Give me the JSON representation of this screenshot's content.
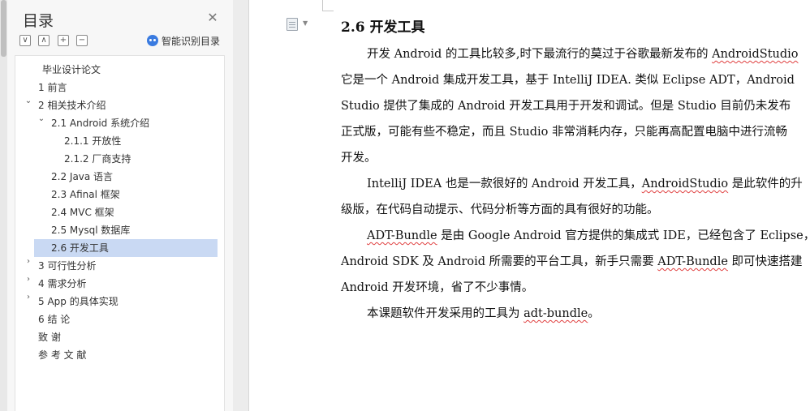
{
  "toc": {
    "title": "目录",
    "smart_label": "智能识别目录",
    "toolbar": {
      "collapse": "∨",
      "expand": "∧",
      "add": "+",
      "remove": "−"
    },
    "items": [
      {
        "label": "毕业设计论文"
      },
      {
        "label": "1 前言"
      },
      {
        "label": "2 相关技术介绍"
      },
      {
        "label": "2.1 Android 系统介绍"
      },
      {
        "label": "2.1.1  开放性"
      },
      {
        "label": "2.1.2 厂商支持"
      },
      {
        "label": "2.2 Java 语言"
      },
      {
        "label": "2.3 Afinal 框架"
      },
      {
        "label": "2.4 MVC 框架"
      },
      {
        "label": "2.5 Mysql 数据库"
      },
      {
        "label": "2.6  开发工具"
      },
      {
        "label": "3  可行性分析"
      },
      {
        "label": "4  需求分析"
      },
      {
        "label": "5 App 的具体实现"
      },
      {
        "label": "6   结  论"
      },
      {
        "label": "致   谢"
      },
      {
        "label": "参  考  文  献"
      }
    ]
  },
  "doc": {
    "heading": "2.6 开发工具",
    "p1": {
      "l1a": "开发 Android 的工具比较多,时下最流行的莫过于谷歌最新发布的 ",
      "l1b": "AndroidStudio",
      "l2": "它是一个 Android 集成开发工具，基于 IntelliJ IDEA. 类似  Eclipse  ADT，Android",
      "l3": "Studio 提供了集成的 Android 开发工具用于开发和调试。但是 Studio 目前仍未发布",
      "l4": "正式版，可能有些不稳定，而且 Studio 非常消耗内存，只能再高配置电脑中进行流畅",
      "l5": "开发。"
    },
    "p2": {
      "l1a": "IntelliJ IDEA 也是一款很好的 Android 开发工具，",
      "l1b": "AndroidStudio",
      "l1c": " 是此软件的升",
      "l2": "级版，在代码自动提示、代码分析等方面的具有很好的功能。"
    },
    "p3": {
      "l1a": "ADT-Bundle",
      "l1b": " 是由 Google Android 官方提供的集成式 IDE，已经包含了 Eclipse，",
      "l2a": "Android SDK 及 Android 所需要的平台工具，新手只需要 ",
      "l2b": "ADT-Bundle",
      "l2c": " 即可快速搭建",
      "l3": "Android 开发环境，省了不少事情。"
    },
    "p4": {
      "l1a": "本课题软件开发采用的工具为 ",
      "l1b": "adt-bundle",
      "l1c": "。"
    }
  }
}
